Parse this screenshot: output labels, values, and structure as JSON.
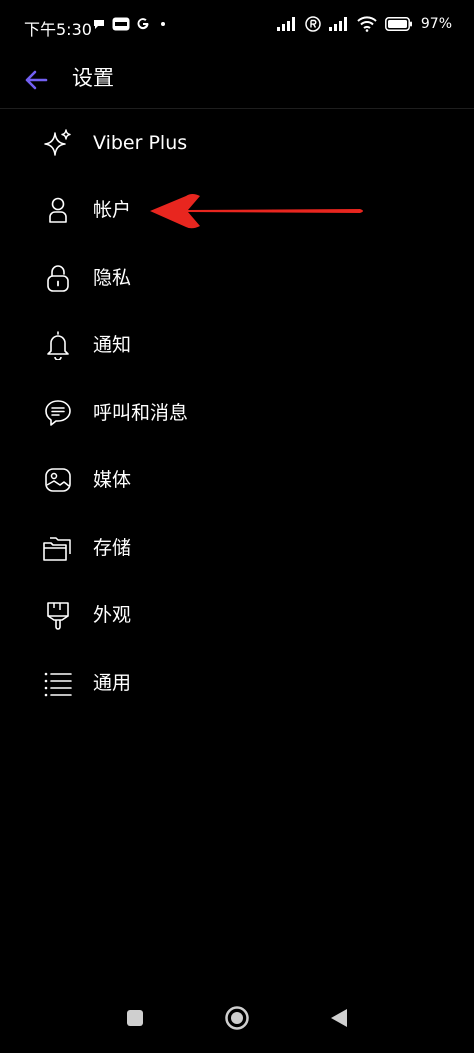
{
  "status_bar": {
    "time": "下午5:30",
    "battery_percent": "97"
  },
  "header": {
    "title": "设置"
  },
  "menu": {
    "items": [
      {
        "label": "Viber Plus",
        "icon": "sparkle-icon"
      },
      {
        "label": "帐户",
        "icon": "person-icon"
      },
      {
        "label": "隐私",
        "icon": "lock-icon"
      },
      {
        "label": "通知",
        "icon": "bell-icon"
      },
      {
        "label": "呼叫和消息",
        "icon": "chat-bubble-icon"
      },
      {
        "label": "媒体",
        "icon": "image-icon"
      },
      {
        "label": "存储",
        "icon": "folder-icon"
      },
      {
        "label": "外观",
        "icon": "paint-brush-icon"
      },
      {
        "label": "通用",
        "icon": "list-icon"
      }
    ]
  },
  "colors": {
    "background": "#000000",
    "accent": "#7360f2",
    "annotation_arrow": "#e8261f"
  }
}
